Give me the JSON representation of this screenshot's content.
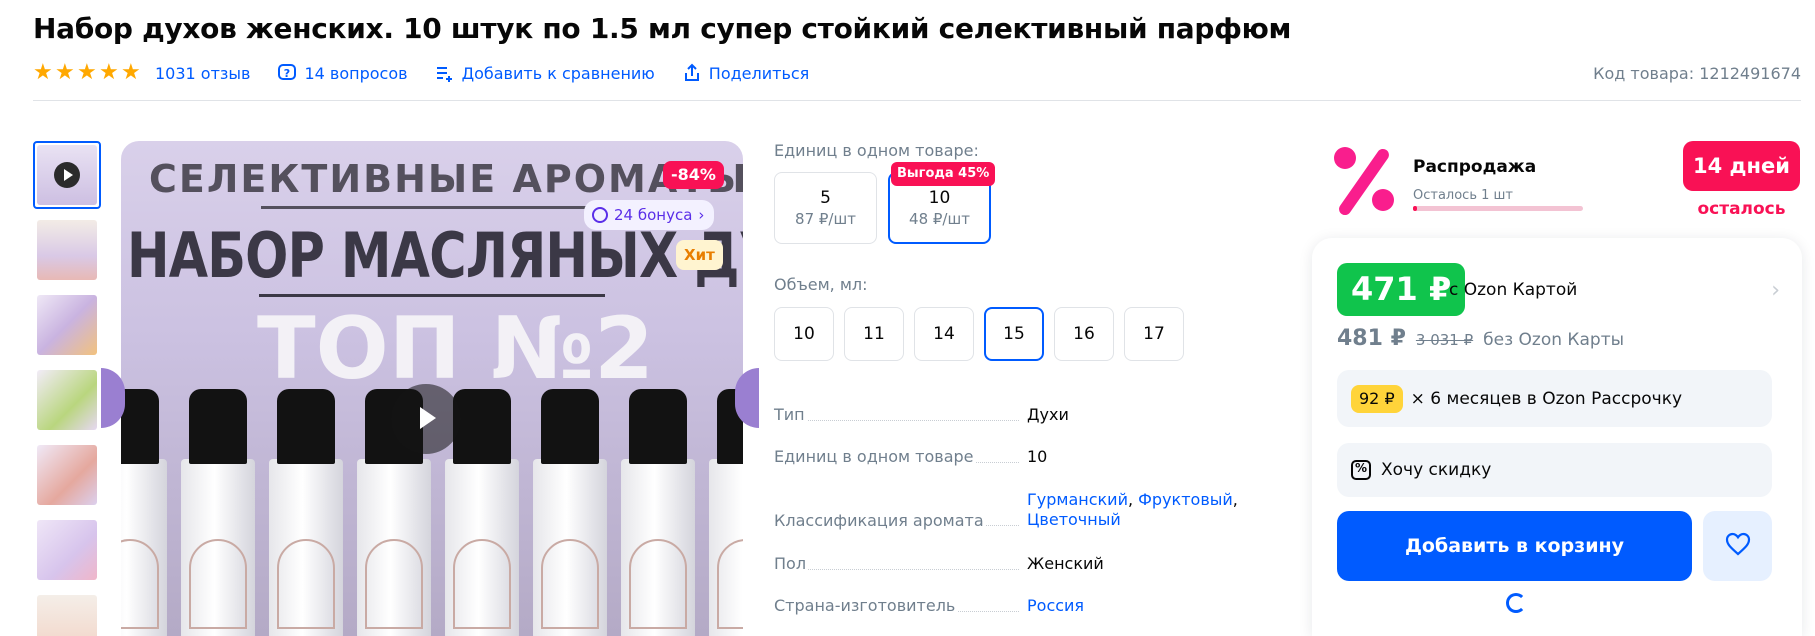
{
  "product": {
    "title": "Набор духов женских. 10 штук по 1.5 мл супер стойкий селективный парфюм",
    "reviews": "1031 отзыв",
    "questions": "14 вопросов",
    "compare": "Добавить к сравнению",
    "share": "Поделиться",
    "sku": "Код товара: 1212491674",
    "rating_stars": 5
  },
  "gallery": {
    "sale_badge": "-84%",
    "bonus_badge": "24 бонуса",
    "hit_badge": "Хит",
    "image_text": {
      "line1": "СЕЛЕКТИВНЫЕ АРОМАТЫ",
      "line2": "НАБОР МАСЛЯНЫХ ДУХОВ",
      "line3": "ТОП №2"
    }
  },
  "options": {
    "units_label": "Единиц в одном товаре:",
    "units": [
      {
        "value": "5",
        "price": "87 ₽/шт",
        "badge": ""
      },
      {
        "value": "10",
        "price": "48 ₽/шт",
        "badge": "Выгода 45%"
      }
    ],
    "volume_label": "Объем, мл:",
    "volumes": [
      "10",
      "11",
      "14",
      "15",
      "16",
      "17"
    ],
    "selected_volume": "15"
  },
  "specs": [
    {
      "key": "Тип",
      "value": "Духи"
    },
    {
      "key": "Единиц в одном товаре",
      "value": "10"
    },
    {
      "key": "Классификация аромата",
      "value_links": [
        "Гурманский",
        "Фруктовый",
        "Цветочный"
      ]
    },
    {
      "key": "Пол",
      "value": "Женский"
    },
    {
      "key": "Страна-изготовитель",
      "value_link": "Россия"
    }
  ],
  "promo": {
    "title": "Распродажа",
    "subtitle": "Осталось 1 шт",
    "days": "14 дней",
    "days_sub": "осталось"
  },
  "buy": {
    "card_price": "471 ₽",
    "card_label": "с Ozon Картой",
    "price": "481 ₽",
    "old_price": "3 031 ₽",
    "no_card_label": "без Ozon Карты",
    "installment_amount": "92 ₽",
    "installment_text": "× 6 месяцев в Ozon Рассрочку",
    "discount_text": "Хочу скидку",
    "add_to_cart": "Добавить в корзину"
  },
  "colors": {
    "accent": "#005bff",
    "sale": "#f91155",
    "green_price": "#10c44c",
    "star": "#ffa800"
  }
}
